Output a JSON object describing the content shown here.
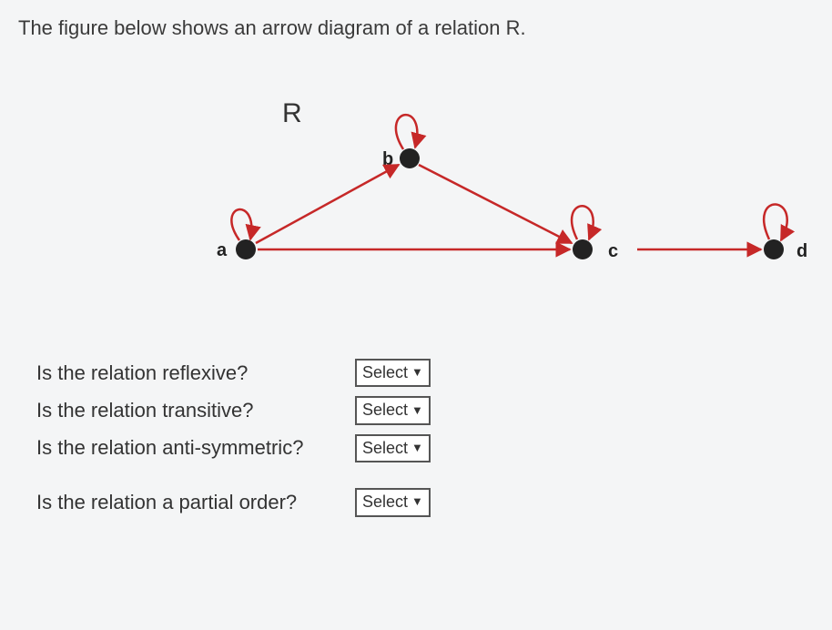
{
  "prompt": "The figure below shows an arrow diagram of a relation R.",
  "diagram": {
    "relation_label": "R",
    "nodes": {
      "a": "a",
      "b": "b",
      "c": "c",
      "d": "d"
    },
    "self_loops": [
      "a",
      "b",
      "c",
      "d"
    ],
    "edges": [
      {
        "from": "a",
        "to": "b"
      },
      {
        "from": "a",
        "to": "c"
      },
      {
        "from": "b",
        "to": "c"
      },
      {
        "from": "c",
        "to": "d"
      }
    ]
  },
  "questions": {
    "q1": "Is the relation reflexive?",
    "q2": "Is the relation transitive?",
    "q3": "Is the relation anti-symmetric?",
    "q4": "Is the relation a partial order?"
  },
  "select_placeholder": "Select"
}
